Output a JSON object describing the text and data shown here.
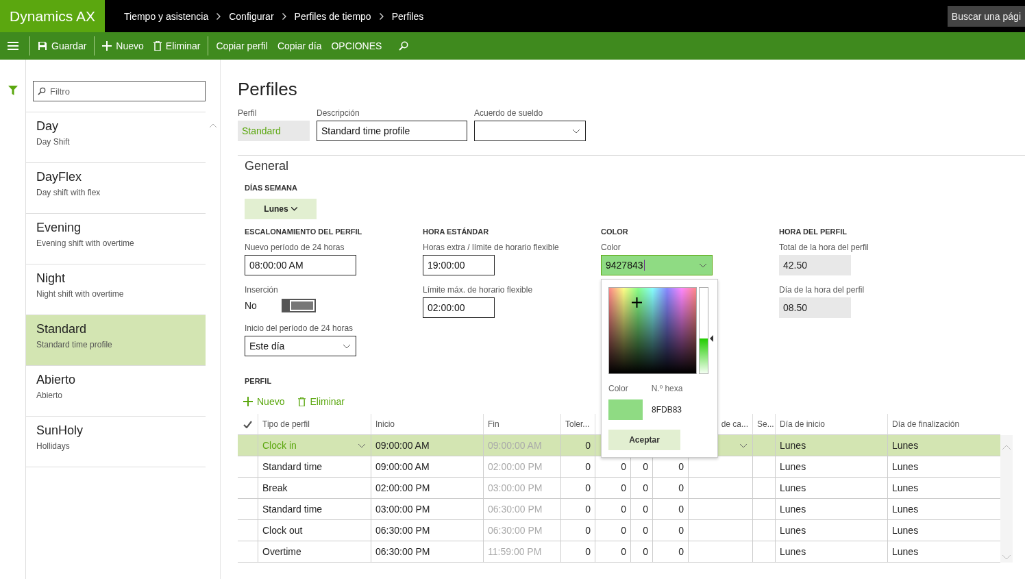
{
  "app": {
    "name": "Dynamics AX"
  },
  "breadcrumbs": [
    "Tiempo y asistencia",
    "Configurar",
    "Perfiles de tiempo",
    "Perfiles"
  ],
  "search_button": {
    "label": "Buscar una pági"
  },
  "actions": [
    {
      "kind": "save",
      "label": "Guardar"
    },
    {
      "kind": "new",
      "label": "Nuevo"
    },
    {
      "kind": "delete",
      "label": "Eliminar"
    },
    {
      "kind": "text",
      "label": "Copiar perfil"
    },
    {
      "kind": "text",
      "label": "Copiar día"
    },
    {
      "kind": "text",
      "label": "OPCIONES"
    },
    {
      "kind": "search"
    }
  ],
  "sidebar": {
    "filter": {
      "placeholder": "Filtro"
    },
    "items": [
      {
        "name": "Day",
        "description": "Day Shift",
        "selected": false
      },
      {
        "name": "DayFlex",
        "description": "Day shift with flex",
        "selected": false
      },
      {
        "name": "Evening",
        "description": "Evening shift with overtime",
        "selected": false
      },
      {
        "name": "Night",
        "description": "Night shift with overtime",
        "selected": false
      },
      {
        "name": "Standard",
        "description": "Standard time profile",
        "selected": true
      },
      {
        "name": "Abierto",
        "description": "Abierto",
        "selected": false
      },
      {
        "name": "SunHoly",
        "description": "Hollidays",
        "selected": false
      }
    ]
  },
  "page_title": "Perfiles",
  "header_fields": {
    "profile": {
      "label": "Perfil",
      "value": "Standard"
    },
    "description": {
      "label": "Descripción",
      "value": "Standard time profile"
    },
    "pay_agreement": {
      "label": "Acuerdo de sueldo"
    }
  },
  "general": {
    "title": "General",
    "weekdays_heading": "DÍAS SEMANA",
    "weekday_button": "Lunes",
    "staggering": {
      "heading": "ESCALONAMIENTO DEL PERFIL",
      "new_period": {
        "label": "Nuevo período de 24 horas",
        "value": "08:00:00 AM"
      },
      "insertion": {
        "label": "Inserción",
        "state_text": "No",
        "on": false
      },
      "period_start": {
        "label": "Inicio del período de 24 horas",
        "value": "Este día"
      }
    },
    "standard_time": {
      "heading": "HORA ESTÁNDAR",
      "overtime_limit": {
        "label": "Horas extra / límite de horario flexible",
        "value": "19:00:00"
      },
      "max_flex": {
        "label": "Límite máx. de horario flexible",
        "value": "02:00:00"
      }
    },
    "color": {
      "heading": "COLOR",
      "label": "Color",
      "value": "9427843"
    },
    "profile_time": {
      "heading": "HORA DEL PERFIL",
      "total": {
        "label": "Total de la hora del perfil",
        "value": "42.50"
      },
      "day": {
        "label": "Día de la hora del perfil",
        "value": "08.50"
      }
    }
  },
  "color_picker": {
    "level": 0.41,
    "color_label": "Color",
    "hex_label": "N.º hexa",
    "hex": "8FDB83",
    "accept_button": "Aceptar"
  },
  "profile_section": {
    "heading": "PERFIL",
    "new_button": "Nuevo",
    "delete_button": "Eliminar"
  },
  "table": {
    "columns": [
      "Tipo de perfil",
      "Inicio",
      "Fin",
      "Toler...",
      null,
      null,
      null,
      "de ca...",
      "Se...",
      "Día de inicio",
      "Día de finalización"
    ],
    "rows": [
      {
        "selected": true,
        "cells": [
          "Clock in",
          "09:00:00 AM",
          "09:00:00 AM",
          "0",
          null,
          null,
          null,
          null,
          null,
          "Lunes",
          "Lunes"
        ]
      },
      {
        "selected": false,
        "cells": [
          "Standard time",
          "09:00:00 AM",
          "02:00:00 PM",
          "0",
          "0",
          "0",
          "0",
          null,
          null,
          "Lunes",
          "Lunes"
        ]
      },
      {
        "selected": false,
        "cells": [
          "Break",
          "02:00:00 PM",
          "03:00:00 PM",
          "0",
          "0",
          "0",
          "0",
          null,
          null,
          "Lunes",
          "Lunes"
        ]
      },
      {
        "selected": false,
        "cells": [
          "Standard time",
          "03:00:00 PM",
          "06:30:00 PM",
          "0",
          "0",
          "0",
          "0",
          null,
          null,
          "Lunes",
          "Lunes"
        ]
      },
      {
        "selected": false,
        "cells": [
          "Clock out",
          "06:30:00 PM",
          "06:30:00 PM",
          "0",
          "0",
          "0",
          "0",
          null,
          null,
          "Lunes",
          "Lunes"
        ]
      },
      {
        "selected": false,
        "cells": [
          "Overtime",
          "06:30:00 PM",
          "11:59:00 PM",
          "0",
          "0",
          "0",
          "0",
          null,
          null,
          "Lunes",
          "Lunes"
        ]
      }
    ]
  }
}
